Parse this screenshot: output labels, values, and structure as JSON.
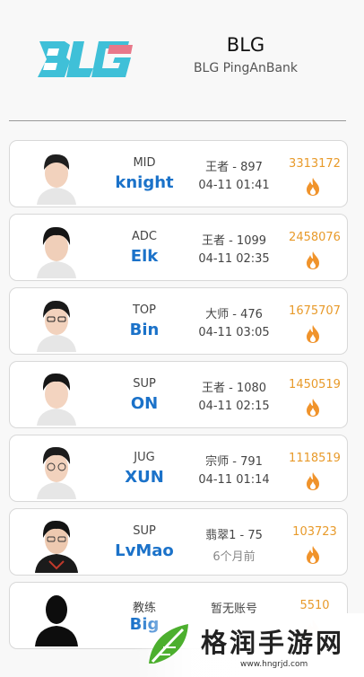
{
  "team": {
    "name": "BLG",
    "subtitle": "BLG PingAnBank",
    "logo_text": "BLG"
  },
  "players": [
    {
      "role": "MID",
      "name": "knight",
      "rank": "王者 - 897",
      "time": "04-11 01:41",
      "score": "3313172"
    },
    {
      "role": "ADC",
      "name": "Elk",
      "rank": "王者 - 1099",
      "time": "04-11 02:35",
      "score": "2458076"
    },
    {
      "role": "TOP",
      "name": "Bin",
      "rank": "大师 - 476",
      "time": "04-11 03:05",
      "score": "1675707"
    },
    {
      "role": "SUP",
      "name": "ON",
      "rank": "王者 - 1080",
      "time": "04-11 02:15",
      "score": "1450519"
    },
    {
      "role": "JUG",
      "name": "XUN",
      "rank": "宗师 - 791",
      "time": "04-11 01:14",
      "score": "1118519"
    },
    {
      "role": "SUP",
      "name": "LvMao",
      "rank": "翡翠1 - 75",
      "time": "6个月前",
      "score": "103723"
    },
    {
      "role": "教练",
      "name": "Big",
      "rank": "暂无账号",
      "time": "",
      "score": "5510"
    }
  ],
  "watermark": {
    "title": "格润手游网",
    "url": "www.hngrjd.com"
  },
  "colors": {
    "accent_blue": "#1b72c9",
    "score_orange": "#e89a2a",
    "logo_cyan": "#3fc0d8",
    "logo_pink": "#e8788a"
  },
  "icons": {
    "trend": "fire-icon",
    "avatar": "player-avatar"
  }
}
